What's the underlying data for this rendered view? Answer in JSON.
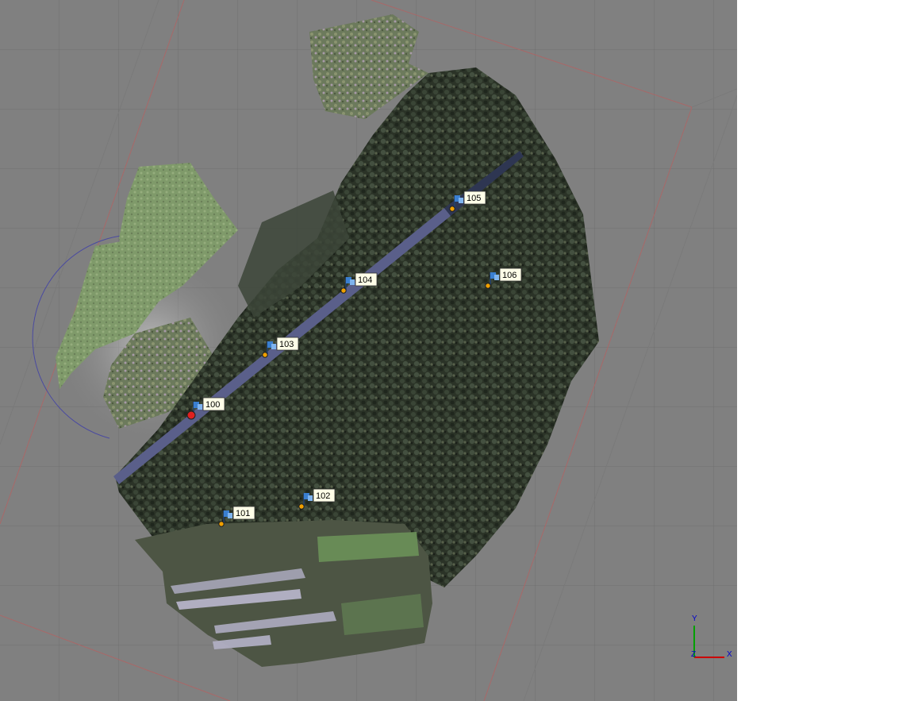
{
  "viewport": {
    "background": "#808080",
    "grid_color": "#6f6f6f",
    "bounding_box_color": "#a86868"
  },
  "markers": [
    {
      "id": "100",
      "label": "100",
      "selected": true
    },
    {
      "id": "101",
      "label": "101",
      "selected": false
    },
    {
      "id": "102",
      "label": "102",
      "selected": false
    },
    {
      "id": "103",
      "label": "103",
      "selected": false
    },
    {
      "id": "104",
      "label": "104",
      "selected": false
    },
    {
      "id": "105",
      "label": "105",
      "selected": false
    },
    {
      "id": "106",
      "label": "106",
      "selected": false
    }
  ],
  "axes": {
    "x_label": "X",
    "y_label": "Y",
    "z_label": "Z",
    "x_color": "#cc0000",
    "y_color": "#00a000",
    "z_color": "#0000cc"
  },
  "colors": {
    "marker_point": "#f0a000",
    "marker_selected": "#e02020",
    "flag": "#3a7fd0",
    "label_bg": "#ffffe8",
    "road": "#5a5f8a"
  }
}
